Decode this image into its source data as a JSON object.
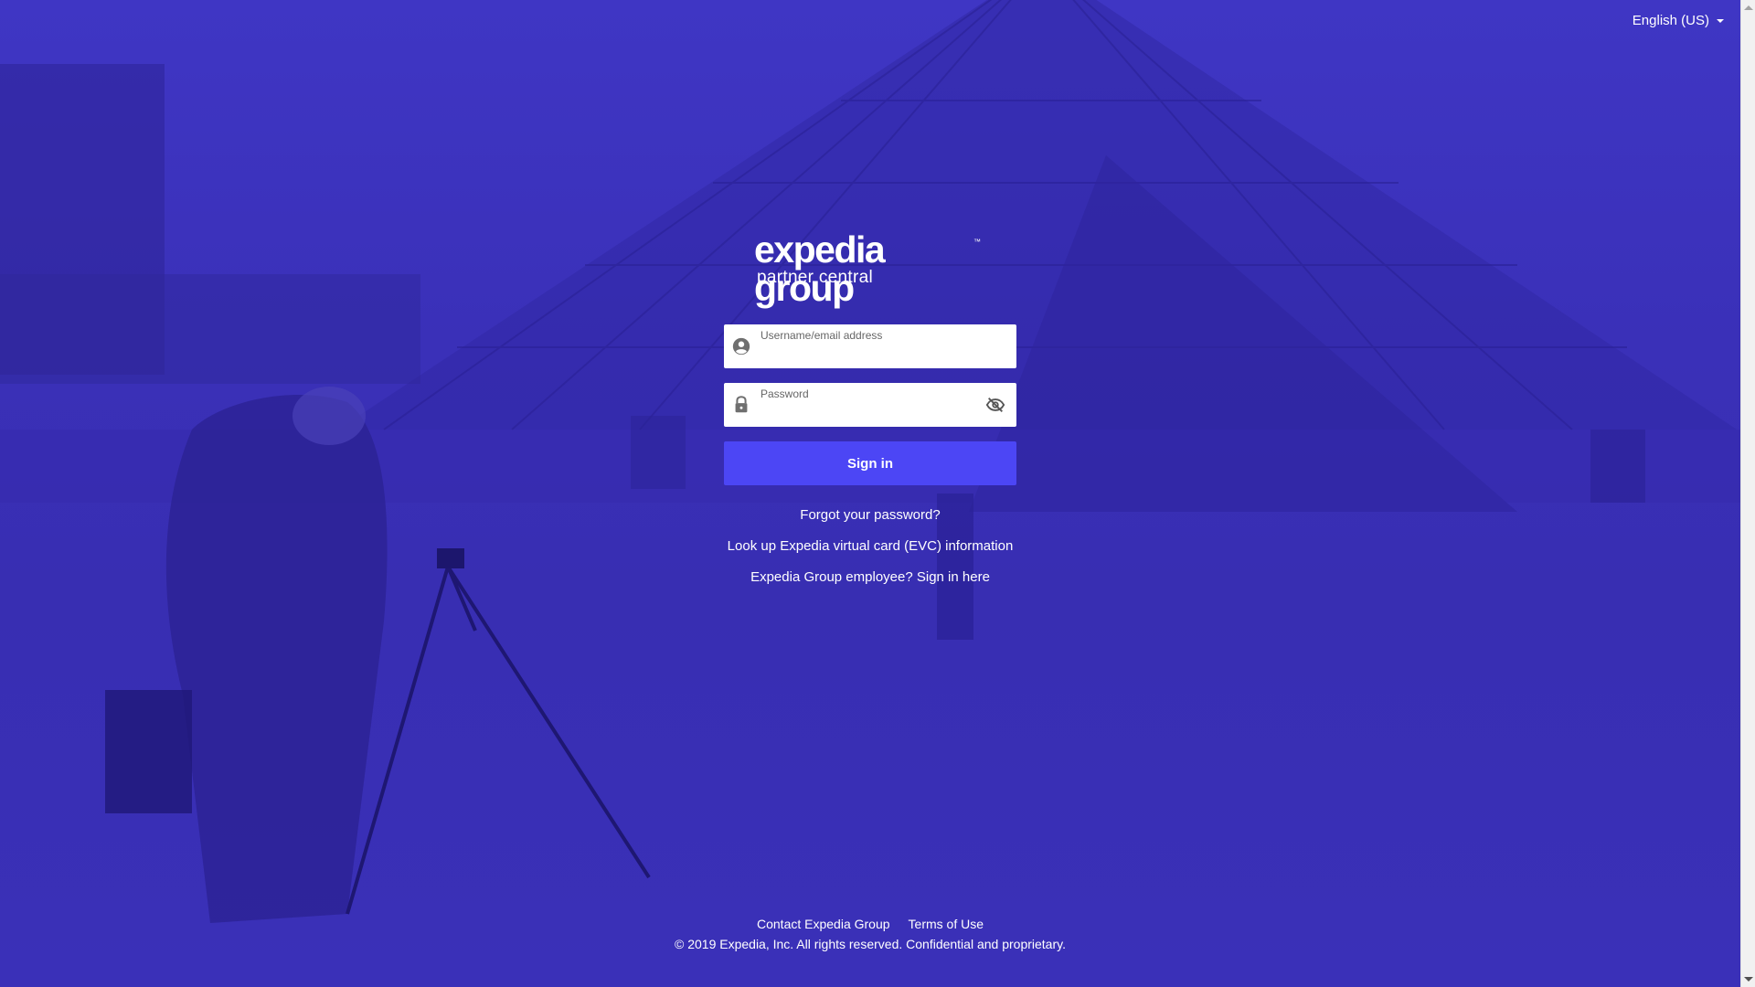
{
  "header": {
    "language": "English (US)"
  },
  "logo": {
    "brand": "expedia group",
    "trademark": "™",
    "subtitle": "partner central"
  },
  "form": {
    "username_label": "Username/email address",
    "username_value": "",
    "password_label": "Password",
    "password_value": "",
    "signin_label": "Sign in"
  },
  "links": {
    "forgot_password": "Forgot your password?",
    "evc_lookup": "Look up Expedia virtual card (EVC) information",
    "employee_signin": "Expedia Group employee? Sign in here"
  },
  "footer": {
    "contact": "Contact Expedia Group",
    "terms": "Terms of Use",
    "copyright": "© 2019 Expedia, Inc. All rights reserved. Confidential and proprietary."
  },
  "colors": {
    "background_overlay": "#3a30b8",
    "button": "#4c46f5",
    "text": "#ffffff"
  },
  "icons": {
    "username": "person-circle-icon",
    "password": "lock-icon",
    "visibility": "eye-off-icon",
    "language": "chevron-down-icon"
  }
}
